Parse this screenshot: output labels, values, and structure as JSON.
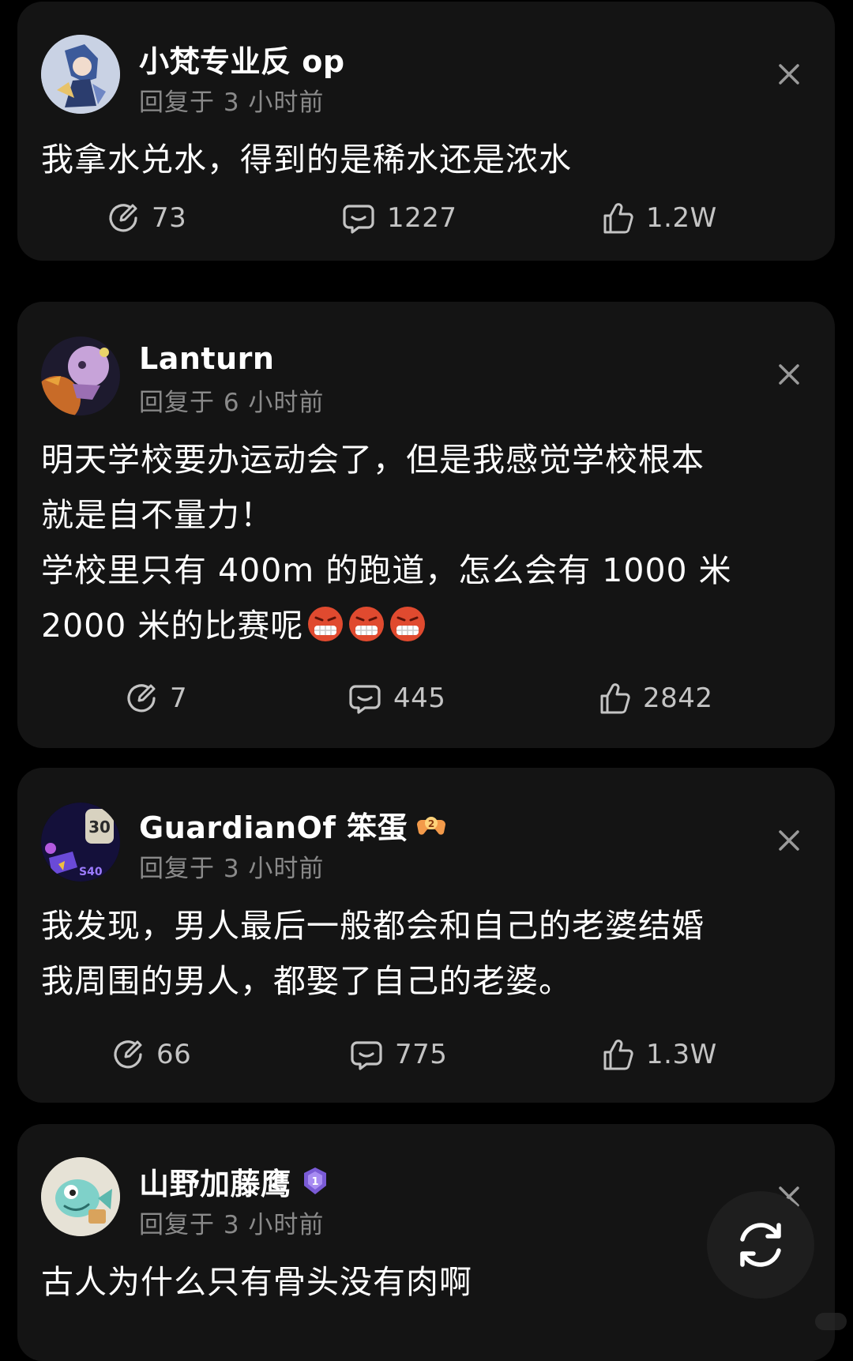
{
  "colors": {
    "background": "#000000",
    "card": "#141414",
    "text_primary": "#ffffff",
    "text_secondary": "#8a8a8a",
    "count_text": "#c4c4c4"
  },
  "posts": [
    {
      "username": "小梵专业反 op",
      "reply_time": "回复于 3 小时前",
      "content": "我拿水兑水，得到的是稀水还是浓水",
      "emoji_count": 0,
      "reposts": "73",
      "comments": "1227",
      "likes": "1.2W",
      "avatar_icon": "anime-character-avatar",
      "badge_icon": ""
    },
    {
      "username": "Lanturn",
      "reply_time": "回复于 6 小时前",
      "content": "明天学校要办运动会了，但是我感觉学校根本\n就是自不量力！\n学校里只有 400m 的跑道，怎么会有 1000 米\n2000 米的比赛呢",
      "emoji_count": 3,
      "emoji_icon": "grimacing-angry-emoji",
      "reposts": "7",
      "comments": "445",
      "likes": "2842",
      "avatar_icon": "cartoon-creature-avatar",
      "badge_icon": ""
    },
    {
      "username": "GuardianOf 笨蛋",
      "reply_time": "回复于 3 小时前",
      "content": "我发现，男人最后一般都会和自己的老婆结婚\n我周围的男人，都娶了自己的老婆。",
      "emoji_count": 0,
      "reposts": "66",
      "comments": "775",
      "likes": "1.3W",
      "avatar_icon": "level-30-badge-avatar",
      "badge_icon": "gamepad-level-2-icon"
    },
    {
      "username": "山野加藤鹰",
      "reply_time": "回复于 3 小时前",
      "content": "古人为什么只有骨头没有肉啊",
      "emoji_count": 0,
      "reposts": "",
      "comments": "",
      "likes": "",
      "avatar_icon": "cartoon-fish-avatar",
      "badge_icon": "rank-1-icon"
    }
  ],
  "fab": {
    "icon": "refresh-icon"
  }
}
